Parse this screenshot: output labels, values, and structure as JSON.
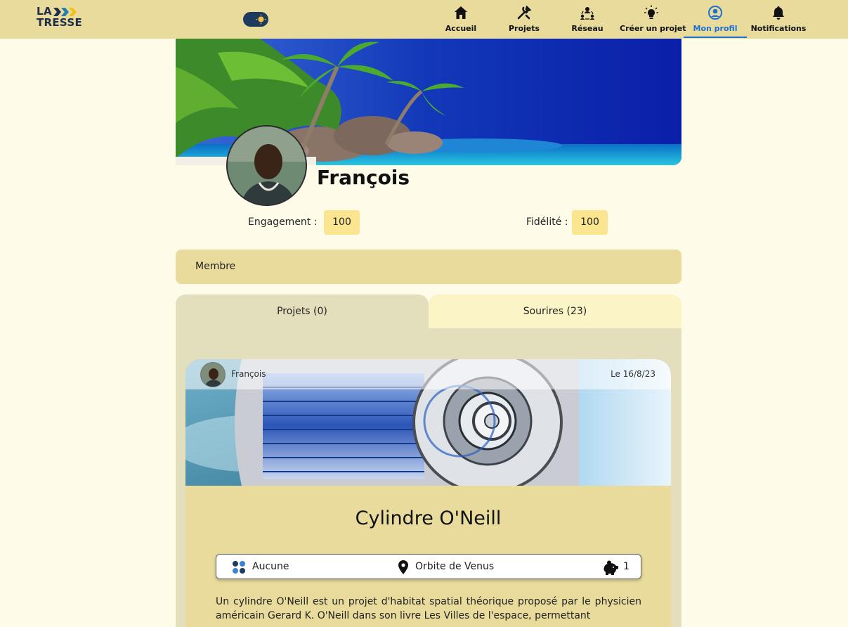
{
  "app": {
    "logo_line1": "LA",
    "logo_line2": "TRESSE"
  },
  "nav": {
    "items": [
      {
        "label": "Accueil",
        "icon": "home-icon"
      },
      {
        "label": "Projets",
        "icon": "tools-icon"
      },
      {
        "label": "Réseau",
        "icon": "network-icon"
      },
      {
        "label": "Créer un projet",
        "icon": "lightbulb-icon"
      },
      {
        "label": "Mon profil",
        "icon": "user-circle-icon",
        "active": true
      },
      {
        "label": "Notifications",
        "icon": "bell-icon"
      }
    ]
  },
  "colors": {
    "navbar": "#e8db9b",
    "page_bg": "#fefbe9",
    "accent": "#1f6fd0",
    "badge": "#fbe590"
  },
  "profile": {
    "name": "François",
    "engagement_label": "Engagement :",
    "engagement_value": "100",
    "fidelite_label": "Fidélité :",
    "fidelite_value": "100",
    "role": "Membre"
  },
  "tabs": [
    {
      "label": "Projets (0)",
      "active": true
    },
    {
      "label": "Sourires (23)",
      "active": false
    }
  ],
  "card": {
    "author": "François",
    "date": "Le 16/8/23",
    "title": "Cylindre O'Neill",
    "category": "Aucune",
    "location": "Orbite de Venus",
    "count": "1",
    "description": "Un cylindre O'Neill est un projet d'habitat spatial théorique proposé par le physicien américain Gerard K. O'Neill dans son livre Les Villes de l'espace, permettant"
  }
}
